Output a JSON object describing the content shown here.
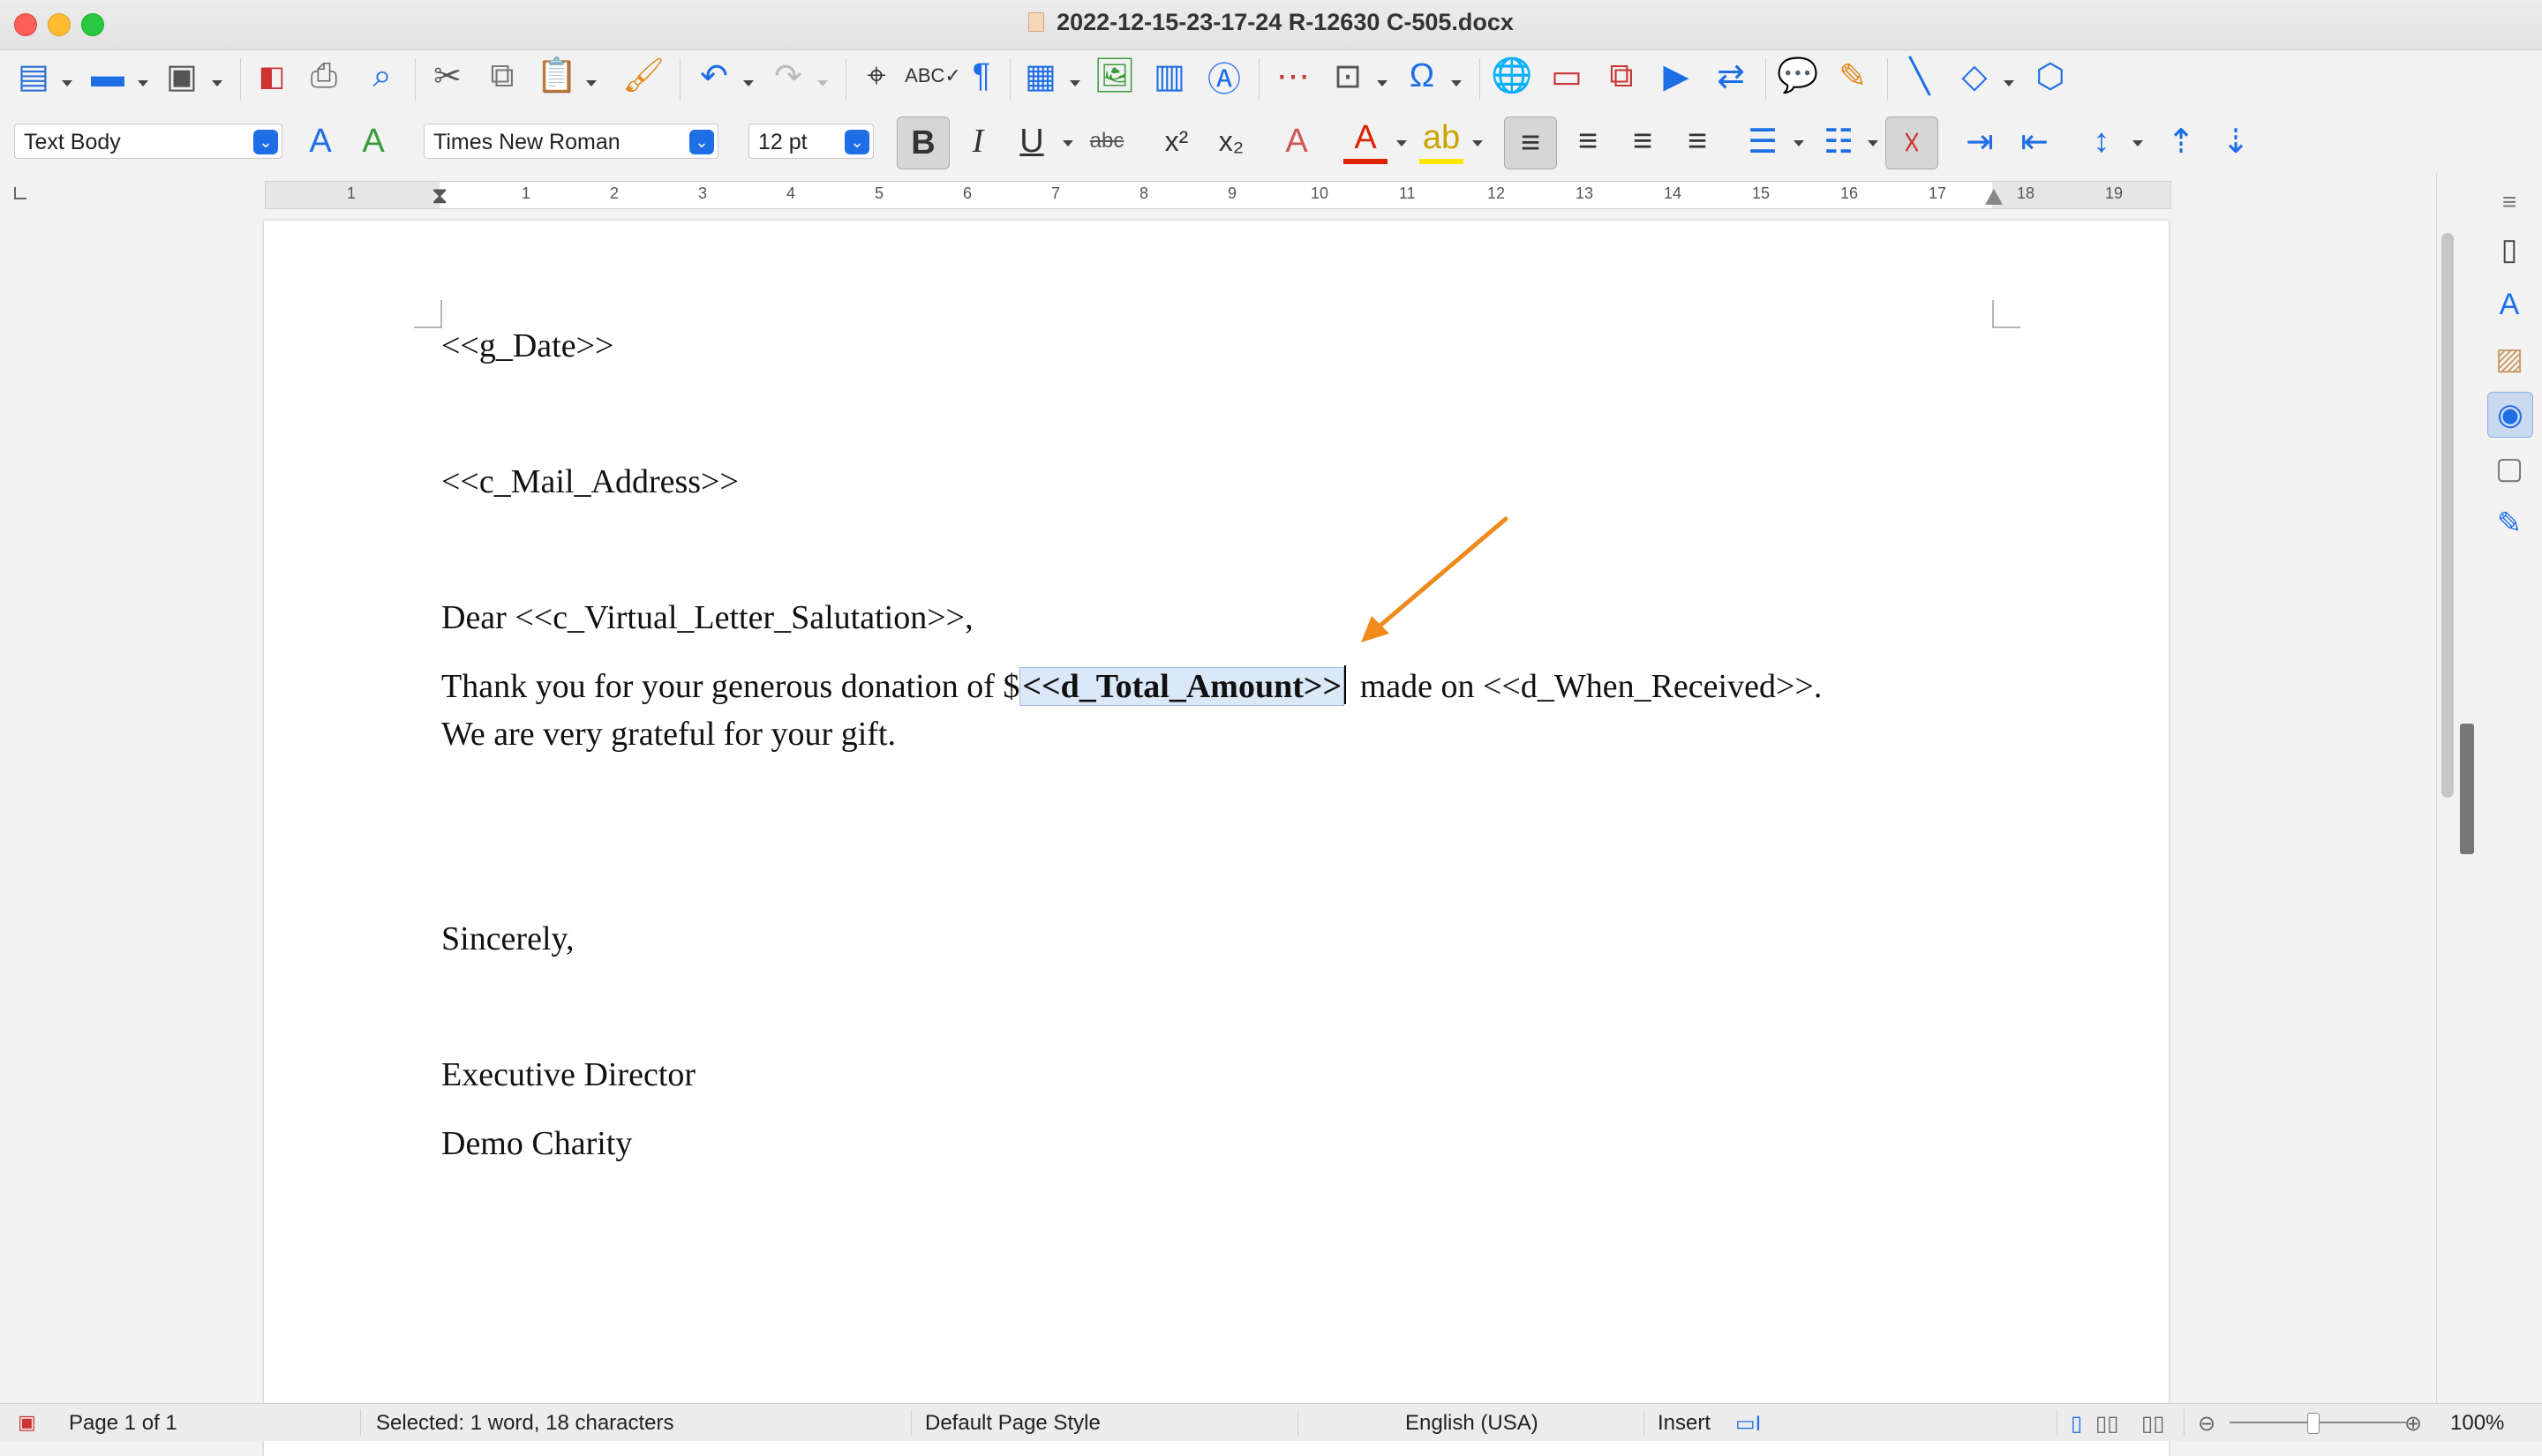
{
  "window": {
    "title": "2022-12-15-23-17-24 R-12630 C-505.docx"
  },
  "formatting": {
    "paragraph_style": "Text Body",
    "font_name": "Times New Roman",
    "font_size": "12 pt",
    "strikethrough_label": "abc"
  },
  "ruler": {
    "numbers": [
      "1",
      "1",
      "2",
      "3",
      "4",
      "5",
      "6",
      "7",
      "8",
      "9",
      "10",
      "11",
      "12",
      "13",
      "14",
      "15",
      "16",
      "17",
      "18",
      "19"
    ]
  },
  "document": {
    "line_date": "<<g_Date>>",
    "line_address": "<<c_Mail_Address>>",
    "line_salutation": "Dear <<c_Virtual_Letter_Salutation>>,",
    "body_before": "Thank you for your generous donation of $",
    "body_selected": "<<d_Total_Amount>>",
    "body_after": " made on <<d_When_Received>>.",
    "body_line2": "We are very grateful for your gift.",
    "closing": "Sincerely,",
    "signer_title": "Executive Director",
    "organization": "Demo Charity"
  },
  "status": {
    "page": "Page 1 of 1",
    "selection": "Selected: 1 word, 18 characters",
    "page_style": "Default Page Style",
    "language": "English (USA)",
    "mode": "Insert",
    "zoom": "100%"
  },
  "colors": {
    "accent": "#1e6ee6",
    "annotation_arrow": "#f08a1c",
    "selection": "#dbe8f8"
  }
}
